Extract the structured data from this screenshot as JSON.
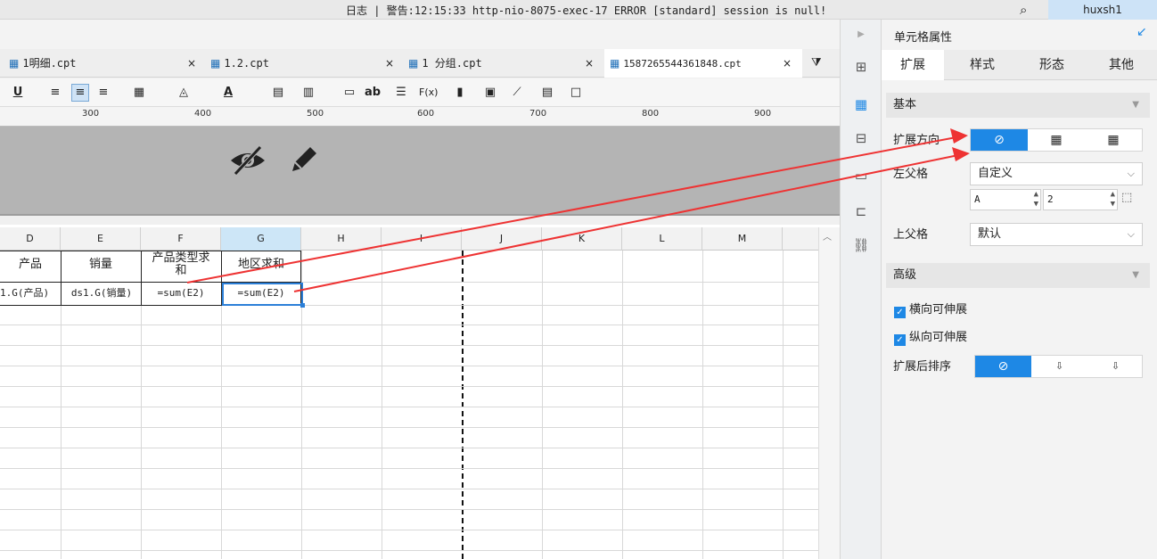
{
  "topbar": {
    "log_text": "日志 | 警告:12:15:33 http-nio-8075-exec-17 ERROR [standard] session is null!",
    "user": "huxsh1"
  },
  "tabs": [
    {
      "label": "1明细.cpt"
    },
    {
      "label": "1.2.cpt"
    },
    {
      "label": "1 分组.cpt"
    },
    {
      "label": "1587265544361848.cpt"
    }
  ],
  "ruler": [
    "300",
    "400",
    "500",
    "600",
    "700",
    "800",
    "900"
  ],
  "columns": [
    "D",
    "E",
    "F",
    "G",
    "H",
    "I",
    "J",
    "K",
    "L",
    "M"
  ],
  "cells": {
    "d1": "产品",
    "e1": "销量",
    "f1_line1": "产品类型求",
    "f1_line2": "和",
    "g1": "地区求和",
    "d2": "1.G(产品)",
    "e2": "ds1.G(销量)",
    "f2": "=sum(E2)",
    "g2": "=sum(E2)"
  },
  "panel": {
    "title": "单元格属性",
    "tabs": [
      "扩展",
      "样式",
      "形态",
      "其他"
    ],
    "basic_section": "基本",
    "expand_direction_label": "扩展方向",
    "left_parent_label": "左父格",
    "left_parent_value": "自定义",
    "left_col_value": "A",
    "left_row_value": "2",
    "upper_parent_label": "上父格",
    "upper_parent_value": "默认",
    "advanced_section": "高级",
    "horizontal_extend": "横向可伸展",
    "vertical_extend": "纵向可伸展",
    "sort_after_label": "扩展后排序"
  },
  "colors": {
    "accent": "#1e88e5",
    "arrow": "#ee3333"
  }
}
